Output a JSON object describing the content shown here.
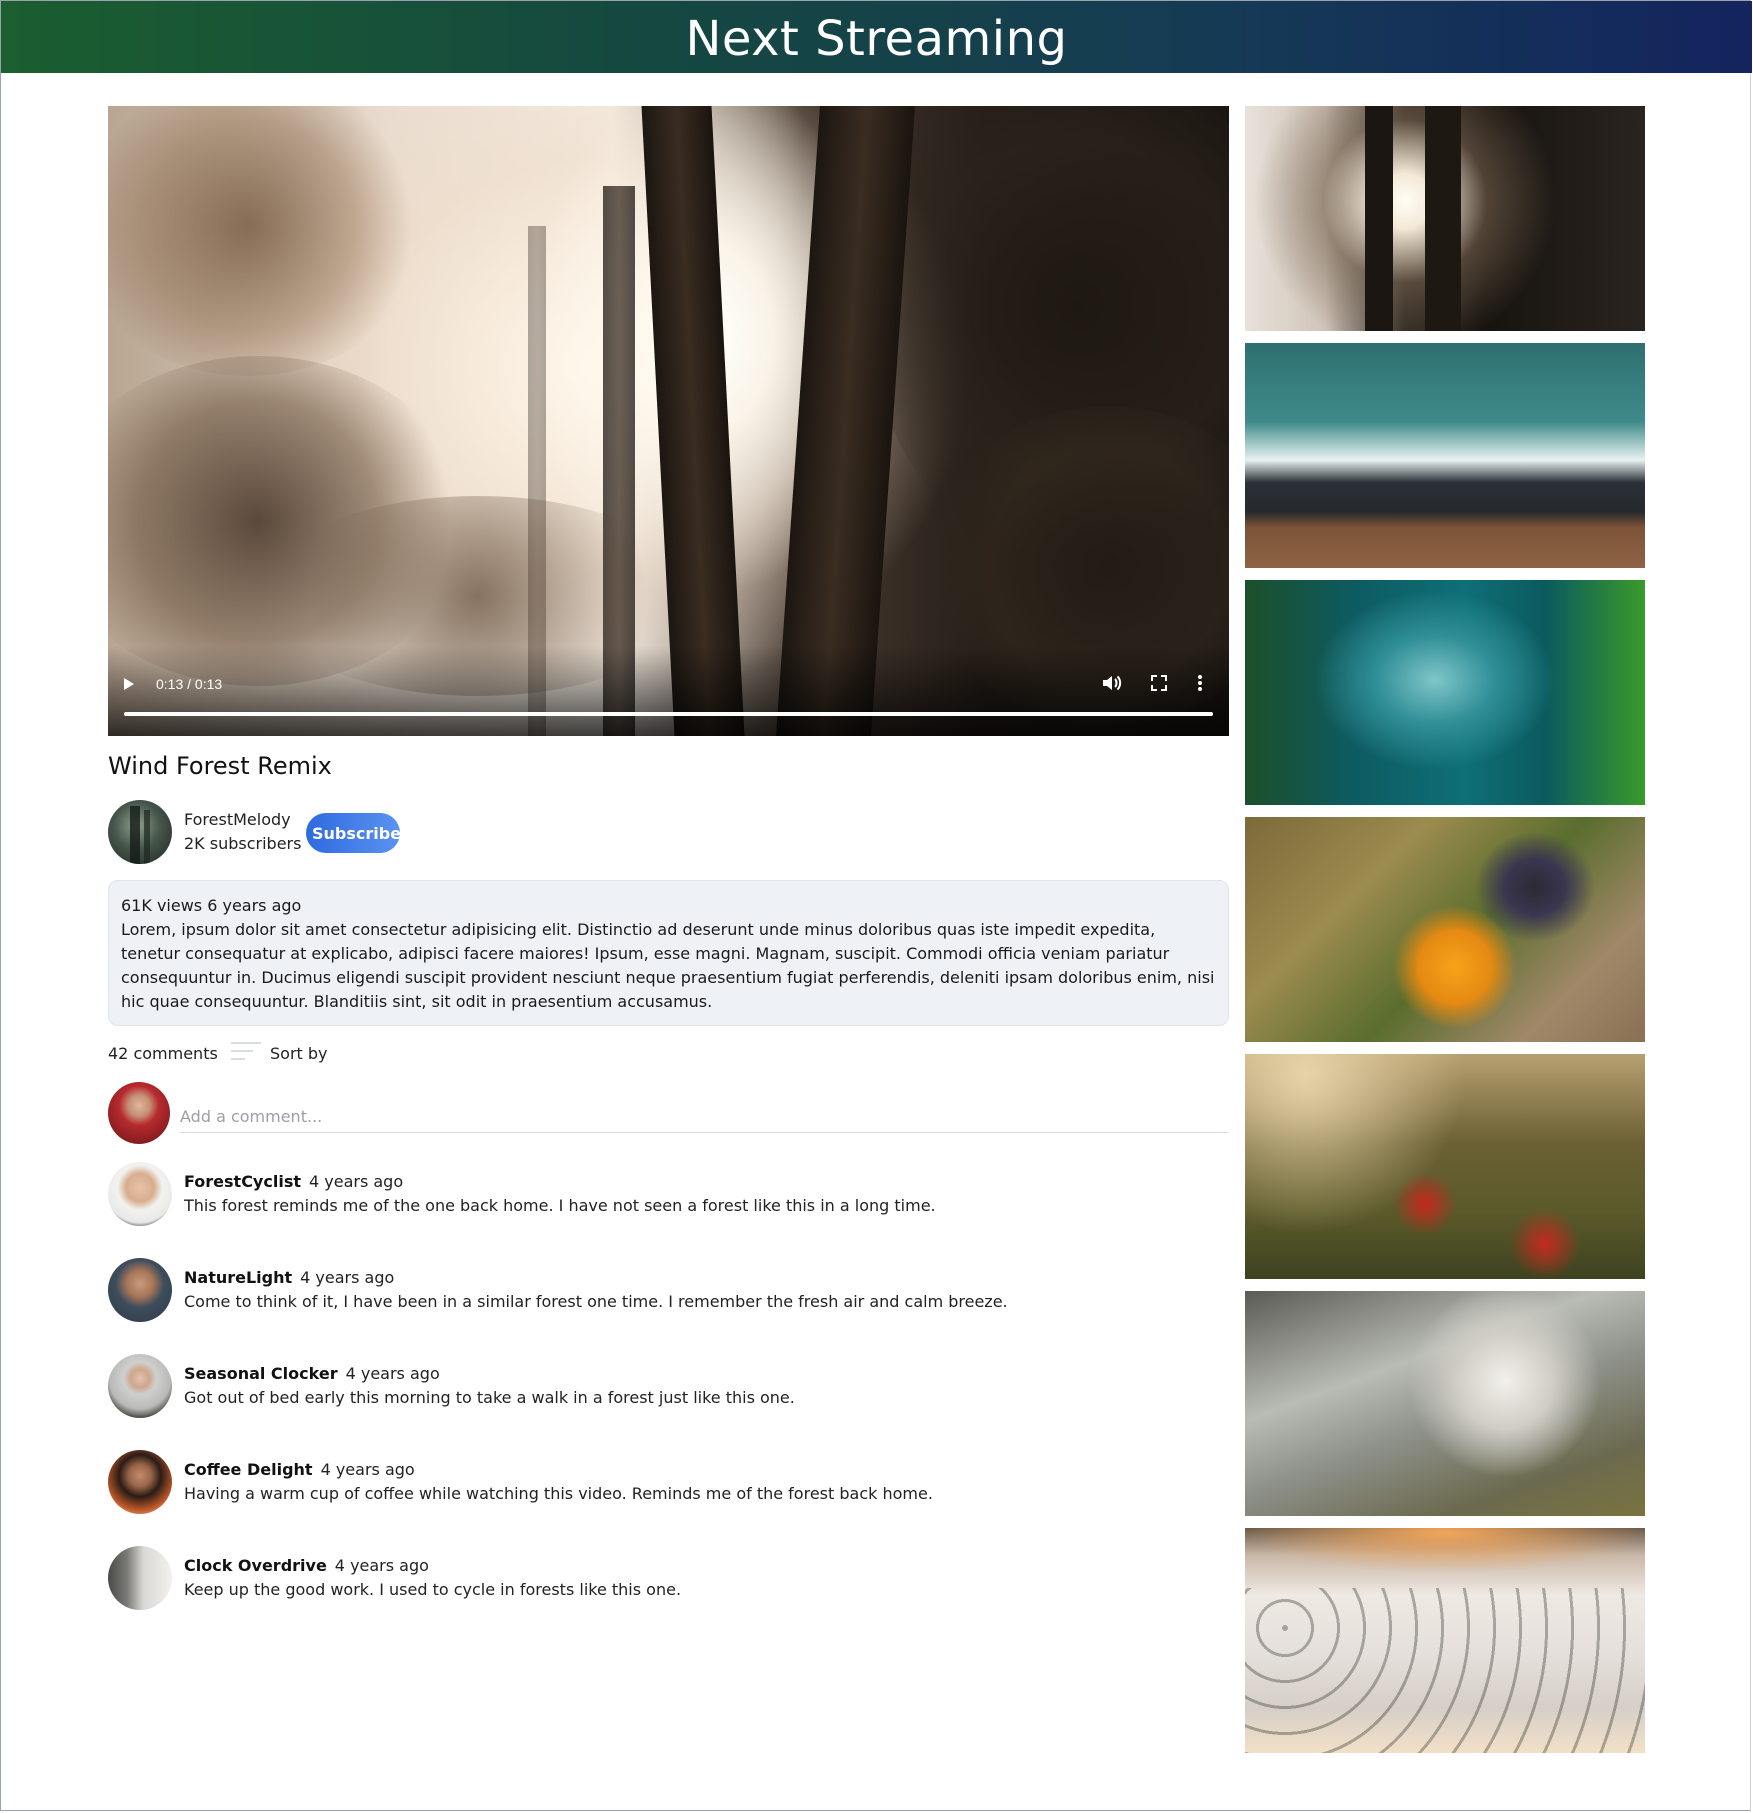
{
  "app": {
    "title": "Next Streaming"
  },
  "player": {
    "time": "0:13 / 0:13",
    "progress": 1.0,
    "icons": [
      "play-icon",
      "volume-icon",
      "fullscreen-icon",
      "more-vertical-icon"
    ]
  },
  "video": {
    "title": "Wind Forest Remix",
    "channel": {
      "name": "ForestMelody",
      "subscribers": "2K subscribers"
    },
    "subscribe_label": "Subscribe",
    "meta": "61K views 6 years ago",
    "description": "Lorem, ipsum dolor sit amet consectetur adipisicing elit. Distinctio ad deserunt unde minus doloribus quas iste impedit expedita, tenetur consequatur at explicabo, adipisci facere maiores! Ipsum, esse magni. Magnam, suscipit. Commodi officia veniam pariatur consequuntur in. Ducimus eligendi suscipit provident nesciunt neque praesentium fugiat perferendis, deleniti ipsam doloribus enim, nisi hic quae consequuntur. Blanditiis sint, sit odit in praesentium accusamus."
  },
  "comments_section": {
    "count_label": "42 comments",
    "sort_label": "Sort by",
    "input_placeholder": "Add a comment...",
    "comments": [
      {
        "author": "ForestCyclist",
        "time": "4 years ago",
        "text": "This forest reminds me of the one back home. I have not seen a forest like this in a long time."
      },
      {
        "author": "NatureLight",
        "time": "4 years ago",
        "text": "Come to think of it, I have been in a similar forest one time. I remember the fresh air and calm breeze."
      },
      {
        "author": "Seasonal Clocker",
        "time": "4 years ago",
        "text": "Got out of bed early this morning to take a walk in a forest just like this one."
      },
      {
        "author": "Coffee Delight",
        "time": "4 years ago",
        "text": "Having a warm cup of coffee while watching this video. Reminds me of the forest back home."
      },
      {
        "author": "Clock Overdrive",
        "time": "4 years ago",
        "text": "Keep up the good work. I used to cycle in forests like this one."
      }
    ]
  },
  "sidebar": {
    "thumbnails": [
      "forest-sunrays",
      "ocean-waves",
      "kelp-fish",
      "butterfly-flower",
      "poppy-field",
      "waterfall",
      "snowy-forest"
    ]
  },
  "colors": {
    "header_start": "#1b5e2f",
    "header_end": "#14245e",
    "subscribe": "#2f6ae0",
    "description_bg": "#eef2f6"
  }
}
